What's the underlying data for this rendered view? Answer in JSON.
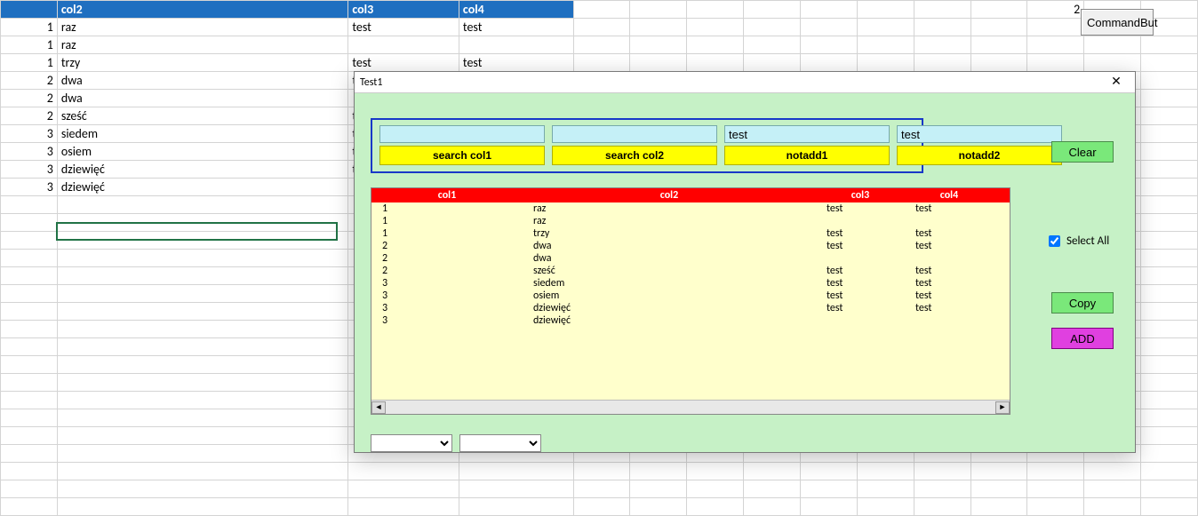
{
  "sheet": {
    "headers": {
      "colB": "col2",
      "colC": "col3",
      "colD": "col4"
    },
    "rows": [
      {
        "a": "1",
        "b": "raz",
        "c": "test",
        "d": "test"
      },
      {
        "a": "1",
        "b": "raz",
        "c": "",
        "d": ""
      },
      {
        "a": "1",
        "b": "trzy",
        "c": "test",
        "d": "test"
      },
      {
        "a": "2",
        "b": "dwa",
        "c": "te",
        "d": ""
      },
      {
        "a": "2",
        "b": "dwa",
        "c": "",
        "d": ""
      },
      {
        "a": "2",
        "b": "sześć",
        "c": "te",
        "d": ""
      },
      {
        "a": "3",
        "b": "siedem",
        "c": "te",
        "d": ""
      },
      {
        "a": "3",
        "b": "osiem",
        "c": "te",
        "d": ""
      },
      {
        "a": "3",
        "b": "dziewięć",
        "c": "te",
        "d": ""
      },
      {
        "a": "3",
        "b": "dziewięć",
        "c": "",
        "d": ""
      }
    ],
    "topright_value": "2",
    "command_button": "CommandBut"
  },
  "form": {
    "title": "Test1",
    "search": {
      "input1": "",
      "btn1": "search col1",
      "input2": "",
      "btn2": "search col2",
      "input3": "test",
      "btn3": "notadd1",
      "input4": "test",
      "btn4": "notadd2"
    },
    "buttons": {
      "clear": "Clear",
      "copy": "Copy",
      "add": "ADD"
    },
    "selectall": {
      "checked": true,
      "label": "Select All"
    },
    "list_headers": {
      "c1": "col1",
      "c2": "col2",
      "c3": "col3",
      "c4": "col4"
    },
    "list_rows": [
      {
        "c1": "1",
        "c2": "raz",
        "c3": "test",
        "c4": "test"
      },
      {
        "c1": "1",
        "c2": "raz",
        "c3": "",
        "c4": ""
      },
      {
        "c1": "1",
        "c2": "trzy",
        "c3": "test",
        "c4": "test"
      },
      {
        "c1": "2",
        "c2": "dwa",
        "c3": "test",
        "c4": "test"
      },
      {
        "c1": "2",
        "c2": "dwa",
        "c3": "",
        "c4": ""
      },
      {
        "c1": "2",
        "c2": "sześć",
        "c3": "test",
        "c4": "test"
      },
      {
        "c1": "3",
        "c2": "siedem",
        "c3": "test",
        "c4": "test"
      },
      {
        "c1": "3",
        "c2": "osiem",
        "c3": "test",
        "c4": "test"
      },
      {
        "c1": "3",
        "c2": "dziewięć",
        "c3": "test",
        "c4": "test"
      },
      {
        "c1": "3",
        "c2": "dziewięć",
        "c3": "",
        "c4": ""
      }
    ],
    "combo1": "",
    "combo2": ""
  }
}
